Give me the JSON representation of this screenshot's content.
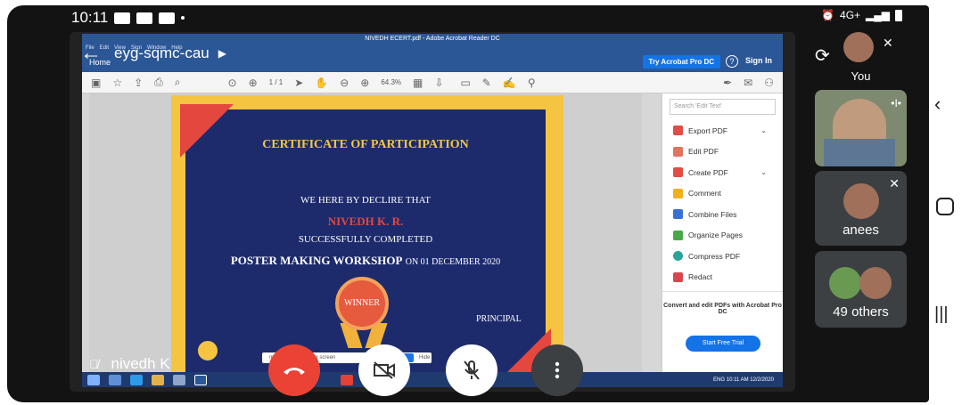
{
  "status": {
    "time": "10:11",
    "signal": "4G+"
  },
  "meet": {
    "code": "eyg-sqmc-cau",
    "presenter": "nivedh K",
    "banner_text": "meet.go... ...ing your screen",
    "banner_hide": "Hide"
  },
  "acrobat": {
    "window_title": "NIVEDH ECERT.pdf - Adobe Acrobat Reader DC",
    "menu": [
      "File",
      "Edit",
      "View",
      "Sign",
      "Window",
      "Help"
    ],
    "nav_home": "Home",
    "try_button": "Try Acrobat Pro DC",
    "sign_in": "Sign In",
    "page_indicator": "1 / 1",
    "zoom": "64.3%",
    "search_placeholder": "Search 'Edit Text'",
    "tools": [
      "Export PDF",
      "Edit PDF",
      "Create PDF",
      "Comment",
      "Combine Files",
      "Organize Pages",
      "Compress PDF",
      "Redact"
    ],
    "promo": "Convert and edit PDFs with Acrobat Pro DC",
    "trial_button": "Start Free Trial",
    "tray": "10:11 AM 12/2/2020",
    "tray_lang": "ENG"
  },
  "certificate": {
    "title": "CERTIFICATE OF PARTICIPATION",
    "declare": "WE HERE BY DECLIRE THAT",
    "name": "NIVEDH K. R.",
    "completed": "SUCCESSFULLY COMPLETED",
    "workshop": "POSTER MAKING WORKSHOP",
    "date": "ON 01 DECEMBER 2020",
    "badge": "WINNER",
    "principal": "PRINCIPAL"
  },
  "participants": {
    "you": "You",
    "anees": "anees",
    "others": "49 others"
  },
  "colors": {
    "end_call": "#ea4335",
    "acrobat_blue": "#2b5797",
    "cert_navy": "#1d2b6d",
    "cert_gold": "#f5c542"
  }
}
